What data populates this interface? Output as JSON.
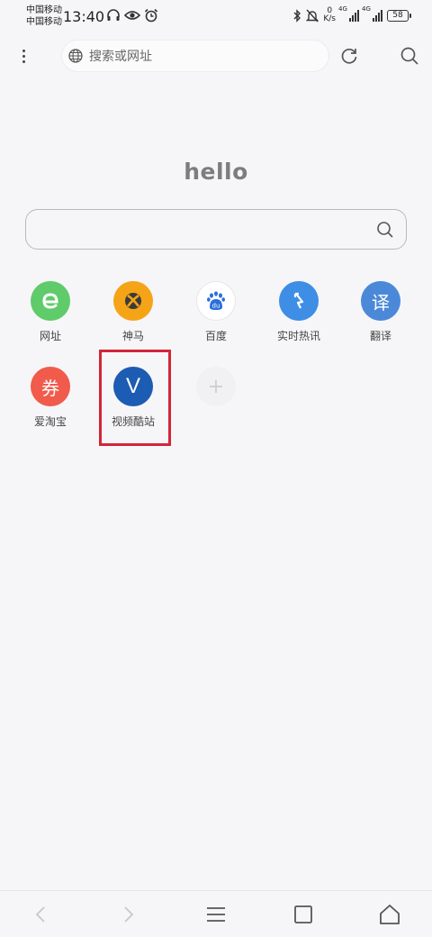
{
  "status_bar": {
    "carrier1": "中国移动",
    "carrier2": "中国移动",
    "time": "13:40",
    "netspeed_value": "0",
    "netspeed_unit": "K/s",
    "signal1_label": "4G",
    "signal2_label": "4G",
    "battery": "58",
    "icons": [
      "headphones-icon",
      "eye-icon",
      "alarm-icon",
      "bluetooth-icon",
      "mute-bell-icon"
    ]
  },
  "toolbar": {
    "menu_icon": "more-vertical-icon",
    "address_placeholder": "搜索或网址",
    "refresh_icon": "refresh-icon",
    "search_icon": "search-icon"
  },
  "home": {
    "logo_text": "hello",
    "search_icon": "search-icon"
  },
  "shortcuts": [
    {
      "label": "网址",
      "icon": "e-logo-icon",
      "color": "#5fcb6a"
    },
    {
      "label": "神马",
      "icon": "xbox-logo-icon",
      "color": "#f5a417"
    },
    {
      "label": "百度",
      "icon": "baidu-paw-icon",
      "color": "#ffffff"
    },
    {
      "label": "实时热讯",
      "icon": "arrow-icon",
      "color": "#3e8ee6"
    },
    {
      "label": "翻译",
      "icon": "translate-icon",
      "glyph": "译",
      "color": "#4b89d8"
    },
    {
      "label": "爱淘宝",
      "icon": "coupon-icon",
      "glyph": "券",
      "color": "#f15b4b"
    },
    {
      "label": "视频酷站",
      "icon": "v-logo-icon",
      "glyph": "V",
      "color": "#1c5cb3"
    },
    {
      "label": "",
      "icon": "add-icon",
      "glyph": "+",
      "color": "#f1f1f3"
    }
  ],
  "bottom_nav": [
    "back-icon",
    "forward-icon",
    "menu-icon",
    "tabs-icon",
    "home-icon"
  ]
}
